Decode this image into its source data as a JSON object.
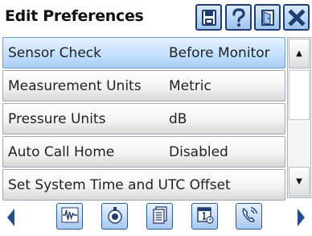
{
  "header": {
    "title": "Edit Preferences"
  },
  "rows": [
    {
      "label": "Sensor Check",
      "value": "Before Monitor",
      "selected": true
    },
    {
      "label": "Measurement Units",
      "value": "Metric"
    },
    {
      "label": "Pressure Units",
      "value": "dB"
    },
    {
      "label": "Auto Call Home",
      "value": "Disabled"
    },
    {
      "label": "Set System Time and UTC Offset",
      "value": ""
    }
  ],
  "header_icons": [
    "save-icon",
    "help-icon",
    "exit-door-icon",
    "close-icon"
  ],
  "footer_icons": [
    "previous-page-arrow-icon",
    "waveform-icon",
    "sensor-icon",
    "documents-icon",
    "calendar-clock-icon",
    "phone-call-icon",
    "next-page-arrow-icon"
  ],
  "colors": {
    "accent": "#1f3d6e",
    "selected_row": "#c4e0ff",
    "close": "#1f4f91"
  }
}
